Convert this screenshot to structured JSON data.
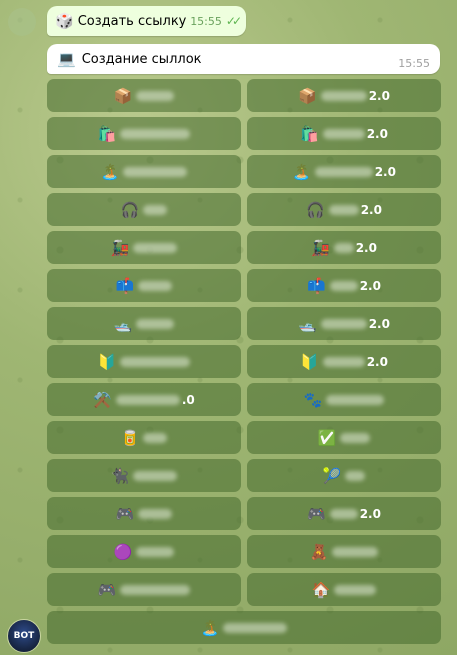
{
  "outgoing": {
    "emoji": "🎲",
    "text": "Создать ссылку",
    "time": "15:55",
    "status": "read"
  },
  "incoming": {
    "emoji": "💻",
    "text": "Создание сыллок",
    "time": "15:55"
  },
  "keyboard": [
    {
      "left": {
        "emoji": "📦",
        "suffix": ""
      },
      "right": {
        "emoji": "📦",
        "suffix": "2.0"
      }
    },
    {
      "left": {
        "emoji": "🛍️",
        "suffix": ""
      },
      "right": {
        "emoji": "🛍️",
        "suffix": "2.0"
      }
    },
    {
      "left": {
        "emoji": "🏝️",
        "suffix": ""
      },
      "right": {
        "emoji": "🏝️",
        "suffix": "2.0"
      }
    },
    {
      "left": {
        "emoji": "🎧",
        "suffix": ""
      },
      "right": {
        "emoji": "🎧",
        "suffix": "2.0"
      }
    },
    {
      "left": {
        "emoji": "🚂",
        "suffix": ""
      },
      "right": {
        "emoji": "🚂",
        "suffix": "2.0"
      }
    },
    {
      "left": {
        "emoji": "📫",
        "suffix": ""
      },
      "right": {
        "emoji": "📫",
        "suffix": "2.0"
      }
    },
    {
      "left": {
        "emoji": "🛥️",
        "suffix": ""
      },
      "right": {
        "emoji": "🛥️",
        "suffix": "2.0"
      }
    },
    {
      "left": {
        "emoji": "🔰",
        "suffix": ""
      },
      "right": {
        "emoji": "🔰",
        "suffix": "2.0"
      }
    },
    {
      "left": {
        "emoji": "⚒️",
        "suffix": ".0"
      },
      "right": {
        "emoji": "🐾",
        "suffix": ""
      }
    },
    {
      "left": {
        "emoji": "🥫",
        "suffix": ""
      },
      "right": {
        "emoji": "✅",
        "suffix": ""
      }
    },
    {
      "left": {
        "emoji": "🐈‍⬛",
        "suffix": ""
      },
      "right": {
        "emoji": "🎾",
        "suffix": ""
      }
    },
    {
      "left": {
        "emoji": "🎮",
        "suffix": ""
      },
      "right": {
        "emoji": "🎮",
        "suffix": "2.0"
      }
    },
    {
      "left": {
        "emoji": "🟣",
        "suffix": ""
      },
      "right": {
        "emoji": "🧸",
        "suffix": ""
      }
    },
    {
      "left": {
        "emoji": "🎮",
        "suffix": ""
      },
      "right": {
        "emoji": "🏠",
        "suffix": ""
      }
    },
    {
      "full": {
        "emoji": "🏝️",
        "suffix": ""
      }
    }
  ],
  "bot_avatar_label": "BOT"
}
